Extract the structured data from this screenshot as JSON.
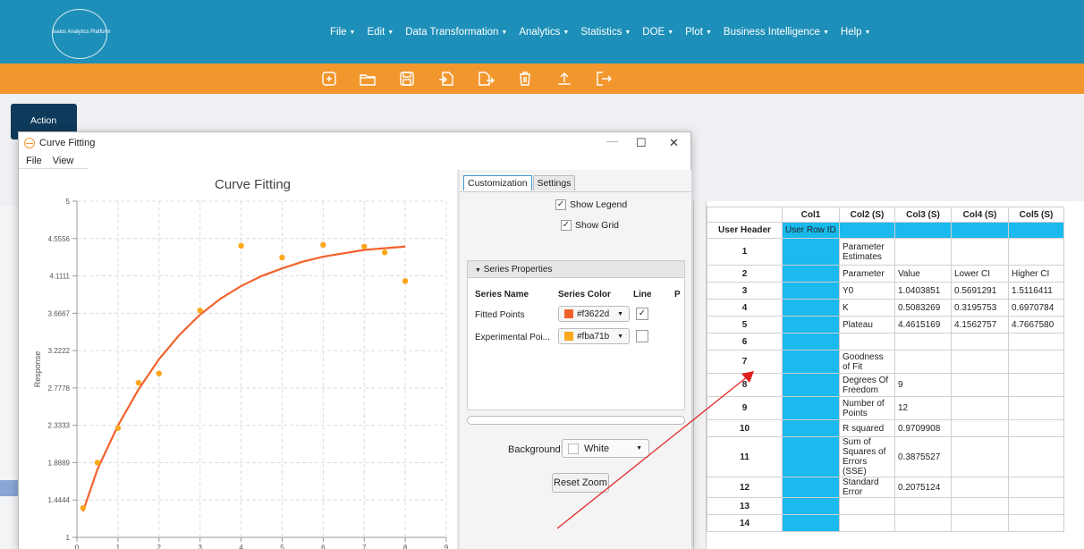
{
  "app": {
    "logo_text": "Isalos Analytics Platform"
  },
  "menu": [
    "File",
    "Edit",
    "Data Transformation",
    "Analytics",
    "Statistics",
    "DOE",
    "Plot",
    "Business Intelligence",
    "Help"
  ],
  "toolbar": {
    "icons": [
      "new-icon",
      "open-icon",
      "save-icon",
      "import-icon",
      "export-icon",
      "delete-icon",
      "upload-icon",
      "exit-icon"
    ]
  },
  "action_label": "Action",
  "dialog": {
    "title": "Curve Fitting",
    "menu": [
      "File",
      "View"
    ],
    "controls": {
      "minimize": "—",
      "maximize": "☐",
      "close": "✕"
    }
  },
  "chart_data": {
    "type": "scatter",
    "title": "Curve Fitting",
    "ylabel": "Response",
    "xlabel": "",
    "xlim": [
      0,
      9
    ],
    "ylim": [
      1,
      5
    ],
    "x_ticks": [
      "0",
      "1",
      "2",
      "3",
      "4",
      "5",
      "6",
      "7",
      "8",
      "9"
    ],
    "y_ticks": [
      "1",
      "1.4444",
      "1.8889",
      "2.3333",
      "2.7778",
      "3.2222",
      "3.6667",
      "4.1111",
      "4.5556",
      "5"
    ],
    "grid": true,
    "series": [
      {
        "name": "Fitted Points",
        "kind": "line",
        "color": "#f3622d",
        "x": [
          0.15,
          0.5,
          1,
          1.5,
          2,
          2.5,
          3,
          3.5,
          4,
          4.5,
          5,
          5.5,
          6,
          6.5,
          7,
          7.5,
          8
        ],
        "y": [
          1.31,
          1.81,
          2.33,
          2.76,
          3.12,
          3.41,
          3.65,
          3.84,
          3.99,
          4.11,
          4.2,
          4.28,
          4.34,
          4.38,
          4.42,
          4.44,
          4.46
        ]
      },
      {
        "name": "Experimental Points",
        "kind": "scatter",
        "color": "#fba71b",
        "x": [
          0.15,
          0.5,
          1,
          1.5,
          2,
          3,
          4,
          5,
          6,
          7,
          7.5,
          8
        ],
        "y": [
          1.35,
          1.89,
          2.3,
          2.84,
          2.95,
          3.7,
          4.47,
          4.33,
          4.48,
          4.46,
          4.39,
          4.05
        ]
      }
    ]
  },
  "panel": {
    "tabs": [
      "Customization",
      "Settings"
    ],
    "show_legend": "Show Legend",
    "show_grid": "Show Grid",
    "series_properties": "Series Properties",
    "columns": [
      "Series Name",
      "Series Color",
      "Line",
      "P"
    ],
    "rows": [
      {
        "name": "Fitted Points",
        "color": "#f3622d",
        "line": true
      },
      {
        "name": "Experimental Poi...",
        "color": "#fba71b",
        "line": false
      }
    ],
    "background_label": "Background:",
    "background_value": "White",
    "reset_zoom": "Reset Zoom"
  },
  "sheet": {
    "columns": [
      "Col1",
      "Col2 (S)",
      "Col3 (S)",
      "Col4 (S)",
      "Col5 (S)"
    ],
    "user_header": "User Header",
    "user_row_id": "User Row ID",
    "rows": [
      {
        "n": "1",
        "c2": "Parameter Estimates",
        "c3": "",
        "c4": "",
        "c5": ""
      },
      {
        "n": "2",
        "c2": "Parameter",
        "c3": "Value",
        "c4": "Lower CI",
        "c5": "Higher CI"
      },
      {
        "n": "3",
        "c2": "Y0",
        "c3": "1.0403851",
        "c4": "0.5691291",
        "c5": "1.5116411"
      },
      {
        "n": "4",
        "c2": "K",
        "c3": "0.5083269",
        "c4": "0.3195753",
        "c5": "0.6970784"
      },
      {
        "n": "5",
        "c2": "Plateau",
        "c3": "4.4615169",
        "c4": "4.1562757",
        "c5": "4.7667580"
      },
      {
        "n": "6",
        "c2": "",
        "c3": "",
        "c4": "",
        "c5": ""
      },
      {
        "n": "7",
        "c2": "Goodness of Fit",
        "c3": "",
        "c4": "",
        "c5": ""
      },
      {
        "n": "8",
        "c2": "Degrees Of Freedom",
        "c3": "9",
        "c4": "",
        "c5": ""
      },
      {
        "n": "9",
        "c2": "Number of Points",
        "c3": "12",
        "c4": "",
        "c5": ""
      },
      {
        "n": "10",
        "c2": "R squared",
        "c3": "0.9709908",
        "c4": "",
        "c5": ""
      },
      {
        "n": "11",
        "c2": "Sum of Squares of Errors (SSE)",
        "c3": "0.3875527",
        "c4": "",
        "c5": ""
      },
      {
        "n": "12",
        "c2": "Standard Error",
        "c3": "0.2075124",
        "c4": "",
        "c5": ""
      },
      {
        "n": "13",
        "c2": "",
        "c3": "",
        "c4": "",
        "c5": ""
      },
      {
        "n": "14",
        "c2": "",
        "c3": "",
        "c4": "",
        "c5": ""
      }
    ]
  },
  "annotation": {
    "color": "#e02020"
  }
}
